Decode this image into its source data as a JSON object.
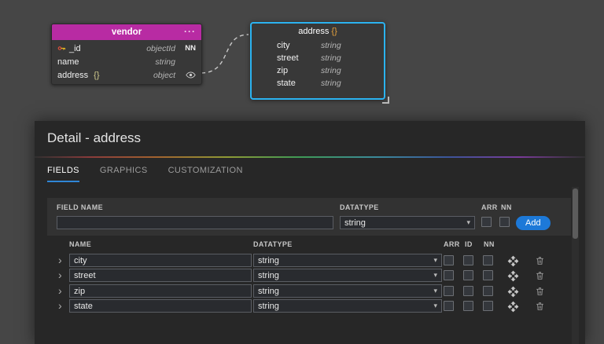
{
  "icons": {
    "menu_dots": "···",
    "caret": "▾",
    "chevron": "›"
  },
  "colors": {
    "vendor_header": "#b82ba3",
    "address_border": "#2bb3f0",
    "tab_accent": "#2f86d6",
    "add_button": "#1d79d8"
  },
  "canvas": {
    "vendor_box": {
      "title": "vendor",
      "fields": [
        {
          "name": "_id",
          "type": "objectId",
          "nn": "NN"
        },
        {
          "name": "name",
          "type": "string",
          "nn": ""
        },
        {
          "name": "address",
          "brace": "{}",
          "type": "object",
          "nn": ""
        }
      ]
    },
    "address_box": {
      "title": "address",
      "brace": "{}",
      "fields": [
        {
          "name": "city",
          "type": "string"
        },
        {
          "name": "street",
          "type": "string"
        },
        {
          "name": "zip",
          "type": "string"
        },
        {
          "name": "state",
          "type": "string"
        }
      ]
    }
  },
  "detail_panel": {
    "title": "Detail - address",
    "tabs": [
      {
        "label": "FIELDS"
      },
      {
        "label": "GRAPHICS"
      },
      {
        "label": "CUSTOMIZATION"
      }
    ],
    "add_form": {
      "field_name_label": "FIELD NAME",
      "field_name_value": "",
      "datatype_label": "DATATYPE",
      "datatype_value": "string",
      "arr_label": "ARR",
      "nn_label": "NN",
      "add_button_label": "Add"
    },
    "fields_table": {
      "name_header": "NAME",
      "datatype_header": "DATATYPE",
      "arr_header": "ARR",
      "id_header": "ID",
      "nn_header": "NN",
      "rows": [
        {
          "name": "city",
          "datatype": "string"
        },
        {
          "name": "street",
          "datatype": "string"
        },
        {
          "name": "zip",
          "datatype": "string"
        },
        {
          "name": "state",
          "datatype": "string"
        }
      ]
    }
  }
}
